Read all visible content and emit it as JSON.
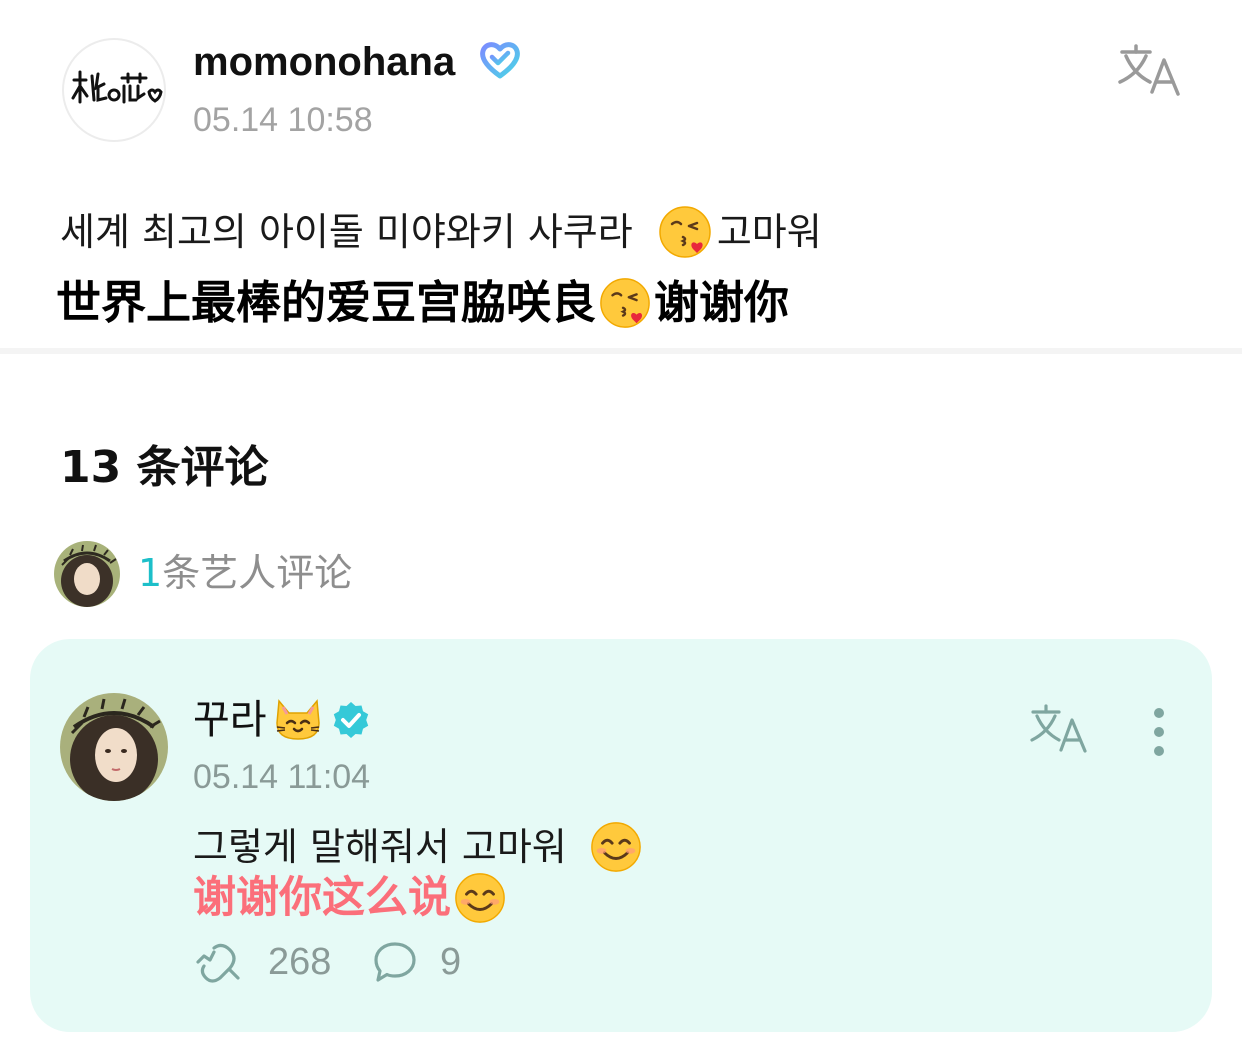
{
  "post": {
    "author": {
      "username": "momonohana",
      "avatar_logo_text": "桃の花",
      "verified": true
    },
    "timestamp": "05.14 10:58",
    "text_ko": "세계 최고의 아이돌 미야와키 사쿠라 ",
    "text_ko_tail": "고마워",
    "text_zh": "世界上最棒的爱豆宫脇咲良",
    "text_zh_tail": "谢谢你",
    "emoji": "kissing-face-with-heart"
  },
  "comments": {
    "header": "13 条评论",
    "artist_comments": {
      "count": "1",
      "label": "条艺人评论"
    },
    "items": [
      {
        "author": {
          "username": "꾸라",
          "name_emoji": "cat-face",
          "verified": true
        },
        "timestamp": "05.14 11:04",
        "text_ko": "그렇게 말해줘서 고마워 ",
        "text_zh": "谢谢你这么说",
        "emoji": "smiling-face-with-smiling-eyes",
        "likes": "268",
        "replies": "9"
      }
    ]
  },
  "colors": {
    "accent_teal": "#1dbfc9",
    "card_background": "#e6faf6",
    "translation_red": "#fb6f7a",
    "muted_text": "#a3a3a3"
  }
}
